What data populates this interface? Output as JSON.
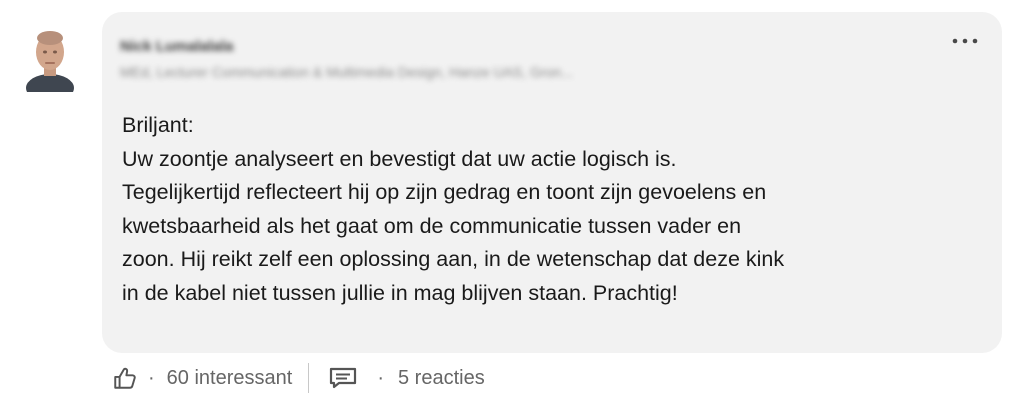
{
  "author": {
    "name": "Nick Lumalalala",
    "headline": "MEd, Lecturer Communication & Multimedia Design, Hanze UAS, Gron..."
  },
  "comment": {
    "lines": [
      "Briljant:",
      "Uw zoontje analyseert en bevestigt dat uw actie logisch is.",
      "Tegelijkertijd reflecteert hij op zijn gedrag en toont zijn gevoelens en",
      "kwetsbaarheid als het gaat om de communicatie tussen vader en",
      "zoon. Hij reikt zelf een oplossing aan, in de wetenschap dat deze kink",
      "in de kabel niet tussen jullie in mag blijven staan. Prachtig!"
    ]
  },
  "actions": {
    "reaction_icon": "thumbs-up-icon",
    "separator": "·",
    "reactions_label": "60 interessant",
    "reply_icon": "comment-icon",
    "replies_label": "5 reacties"
  },
  "menu": {
    "icon": "more-options-icon",
    "label": "···"
  },
  "colors": {
    "bubble_bg": "#f2f2f2",
    "text": "#1a1a1a",
    "muted": "#666666"
  }
}
